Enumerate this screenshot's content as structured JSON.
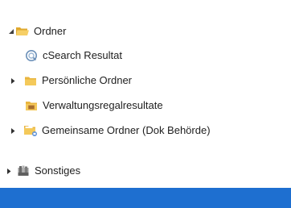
{
  "tree": {
    "root": {
      "label": "Ordner",
      "expanded": true,
      "icon": "folder-open-icon"
    },
    "items": [
      {
        "label": "cSearch Resultat",
        "icon": "search-folder-icon"
      },
      {
        "label": "Persönliche Ordner",
        "icon": "folder-icon",
        "expandable": true,
        "expanded": false
      },
      {
        "label": "Verwaltungsregalresultate",
        "icon": "records-folder-icon"
      },
      {
        "label": "Gemeinsame Ordner (Dok Behörde)",
        "icon": "shared-folder-icon",
        "expandable": true,
        "expanded": false
      }
    ],
    "other": {
      "label": "Sonstiges",
      "icon": "misc-icon",
      "expandable": true,
      "expanded": false
    }
  },
  "colors": {
    "folder_yellow": "#f2c04e",
    "status_bar_blue": "#1e6fd0",
    "text": "#1e1e1e"
  }
}
